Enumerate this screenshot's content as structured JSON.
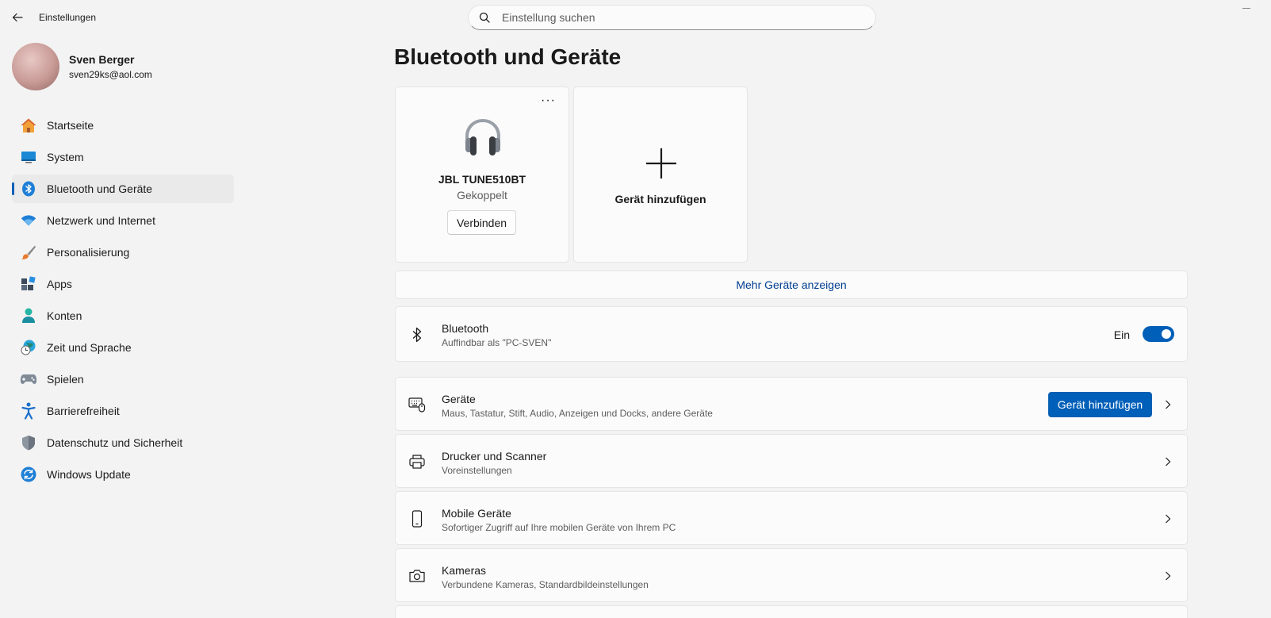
{
  "window": {
    "title": "Einstellungen"
  },
  "search": {
    "placeholder": "Einstellung suchen"
  },
  "profile": {
    "name": "Sven Berger",
    "email": "sven29ks@aol.com"
  },
  "sidebar": {
    "items": [
      {
        "label": "Startseite",
        "icon": "home-icon"
      },
      {
        "label": "System",
        "icon": "monitor-icon"
      },
      {
        "label": "Bluetooth und Geräte",
        "icon": "bluetooth-icon",
        "active": true
      },
      {
        "label": "Netzwerk und Internet",
        "icon": "wifi-icon"
      },
      {
        "label": "Personalisierung",
        "icon": "brush-icon"
      },
      {
        "label": "Apps",
        "icon": "apps-icon"
      },
      {
        "label": "Konten",
        "icon": "person-icon"
      },
      {
        "label": "Zeit und Sprache",
        "icon": "globe-clock-icon"
      },
      {
        "label": "Spielen",
        "icon": "gamepad-icon"
      },
      {
        "label": "Barrierefreiheit",
        "icon": "accessibility-icon"
      },
      {
        "label": "Datenschutz und Sicherheit",
        "icon": "shield-icon"
      },
      {
        "label": "Windows Update",
        "icon": "update-icon"
      }
    ]
  },
  "main": {
    "title": "Bluetooth und Geräte",
    "device_card": {
      "name": "JBL TUNE510BT",
      "status": "Gekoppelt",
      "connect_label": "Verbinden",
      "more_label": "···"
    },
    "add_card": {
      "label": "Gerät hinzufügen"
    },
    "more_devices_label": "Mehr Geräte anzeigen",
    "bluetooth": {
      "title": "Bluetooth",
      "subtitle": "Auffindbar als \"PC-SVEN\"",
      "toggle_label": "Ein"
    },
    "rows": [
      {
        "title": "Geräte",
        "subtitle": "Maus, Tastatur, Stift, Audio, Anzeigen und Docks, andere Geräte",
        "button": "Gerät hinzufügen"
      },
      {
        "title": "Drucker und Scanner",
        "subtitle": "Voreinstellungen"
      },
      {
        "title": "Mobile Geräte",
        "subtitle": "Sofortiger Zugriff auf Ihre mobilen Geräte von Ihrem PC"
      },
      {
        "title": "Kameras",
        "subtitle": "Verbundene Kameras, Standardbildeinstellungen"
      }
    ]
  },
  "colors": {
    "accent": "#005fb8",
    "background": "#f3f3f3",
    "card": "#fbfbfb",
    "link": "#003e92"
  }
}
